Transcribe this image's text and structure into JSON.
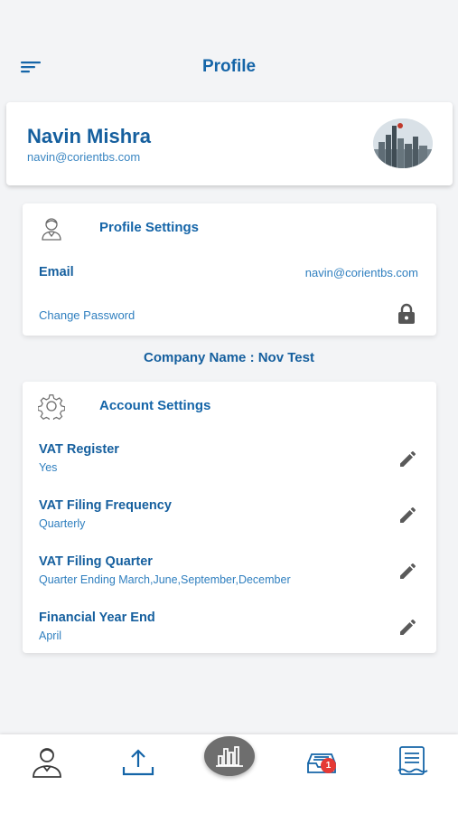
{
  "header": {
    "title": "Profile"
  },
  "profile": {
    "name": "Navin Mishra",
    "email": "navin@corientbs.com"
  },
  "profile_settings": {
    "title": "Profile Settings",
    "email_label": "Email",
    "email_value": "navin@corientbs.com",
    "change_password": "Change Password"
  },
  "company": {
    "text": "Company Name : Nov Test"
  },
  "account_settings": {
    "title": "Account Settings",
    "rows": [
      {
        "label": "VAT Register",
        "value": "Yes"
      },
      {
        "label": "VAT Filing Frequency",
        "value": "Quarterly"
      },
      {
        "label": "VAT Filing Quarter",
        "value": "Quarter Ending March,June,September,December"
      },
      {
        "label": "Financial Year End",
        "value": "April"
      }
    ]
  },
  "bottom_nav": {
    "badge_count": "1"
  },
  "colors": {
    "primary": "#1565a8",
    "badge": "#e53935",
    "center_button": "#6e6e6e"
  }
}
